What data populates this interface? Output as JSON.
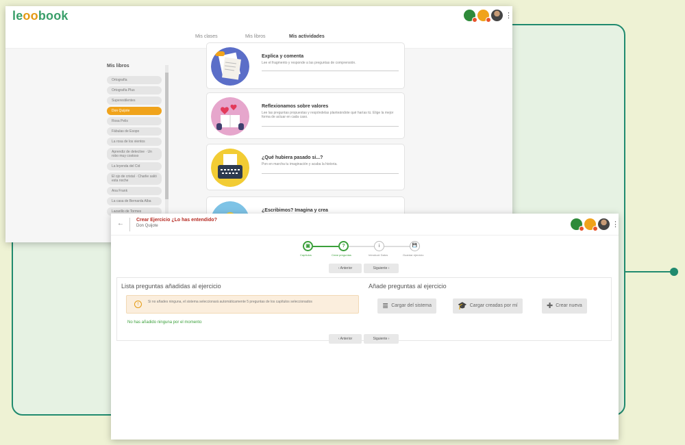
{
  "window1": {
    "logo_prefix": "le",
    "logo_oo": "o",
    "logo_suffix": "book",
    "tabs": [
      {
        "label": "Mis clases"
      },
      {
        "label": "Mis libros"
      },
      {
        "label": "Mis actividades",
        "active": true
      }
    ],
    "libros_title": "Mis libros",
    "books": [
      "Ortografía",
      "Ortografía Plus",
      "Superestilentes",
      "Don Quijote",
      "Rosa Pelis",
      "Fábulas de Esopo",
      "La rosa de los vientos",
      "Aprendiz de detective · Un robo muy costoso",
      "La leyenda del Cid",
      "El ojo de cristal · Charlie salió esta noche",
      "Ana Frank",
      "La casa de Bernarda Alba",
      "Lazarillo de Tormes"
    ],
    "selected_book_index": 3,
    "activities": [
      {
        "title": "Explica y comenta",
        "desc": "Lee el fragmento y responde a las preguntas de comprensión."
      },
      {
        "title": "Reflexionamos sobre valores",
        "desc": "Lee las preguntas propuestas y respóndelas planteándote qué harías tú. Elige la mejor forma de actuar en cada caso."
      },
      {
        "title": "¿Qué hubiera pasado si...?",
        "desc": "Pon en marcha tu imaginación y acaba la historia."
      },
      {
        "title": "¿Escribimos? Imagina y crea",
        "desc": ""
      }
    ],
    "colors": {
      "brand_green": "#3a9f6a",
      "brand_orange": "#f0a31b"
    }
  },
  "window2": {
    "back_icon": "←",
    "title": "Crear Ejercicio ¿Lo has entendido?",
    "subtitle": "Don Quijote",
    "steps": [
      {
        "icon": "▣",
        "label": "Capítulos",
        "done": true
      },
      {
        "icon": "?",
        "label": "Crear preguntas",
        "done": true
      },
      {
        "icon": "i",
        "label": "Introducir Datos",
        "done": false
      },
      {
        "icon": "💾",
        "label": "Guardar ejercicio",
        "done": false
      }
    ],
    "prev_label": "Anterior",
    "next_label": "Siguiente",
    "prev_icon": "‹",
    "next_icon": "›",
    "lista_title": "Lista preguntas añadidas al ejercicio",
    "warning_icon": "!",
    "warning_text": "Si no añades ninguna, el sistema seleccionará automáticamente 5 preguntas de los capítulos seleccionados",
    "no_added": "No has añadido ninguna por el momento",
    "anade_title": "Añade preguntas al ejercicio",
    "buttons": [
      {
        "icon": "database-icon",
        "glyph": "≣",
        "label": "Cargar del sistema"
      },
      {
        "icon": "graduation-cap-icon",
        "glyph": "🎓",
        "label": "Cargar creadas por mí"
      },
      {
        "icon": "plus-icon",
        "glyph": "✚",
        "label": "Crear nueva"
      }
    ]
  }
}
